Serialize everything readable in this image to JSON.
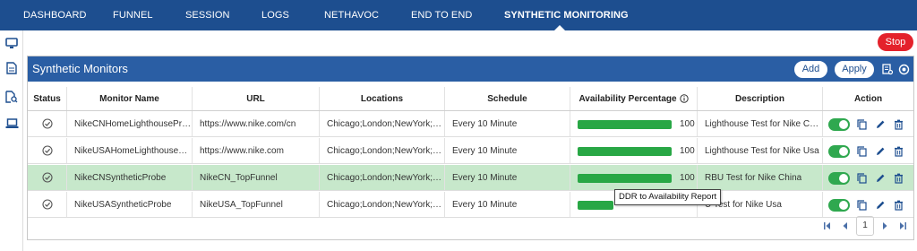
{
  "nav": {
    "tabs": [
      {
        "label": "DASHBOARD"
      },
      {
        "label": "FUNNEL"
      },
      {
        "label": "SESSION"
      },
      {
        "label": "LOGS"
      },
      {
        "label": "NETHAVOC"
      },
      {
        "label": "END TO END"
      },
      {
        "label": "SYNTHETIC MONITORING"
      }
    ],
    "active_tab": "SYNTHETIC MONITORING"
  },
  "sidebar": {
    "icons": [
      "monitor-icon",
      "document-icon",
      "document-search-icon",
      "laptop-icon"
    ]
  },
  "stop_label": "Stop",
  "panel": {
    "title": "Synthetic Monitors",
    "add_label": "Add",
    "apply_label": "Apply",
    "icons": [
      "report-icon",
      "refresh-settings-icon"
    ]
  },
  "table": {
    "headers": {
      "status": "Status",
      "name": "Monitor Name",
      "url": "URL",
      "locations": "Locations",
      "schedule": "Schedule",
      "availability": "Availability Percentage",
      "description": "Description",
      "action": "Action"
    },
    "rows": [
      {
        "name": "NikeCNHomeLighthousePro...",
        "url": "https://www.nike.com/cn",
        "locations": "Chicago;London;NewYork;T...",
        "schedule": "Every 10 Minute",
        "availability": 100,
        "availability_label": "100",
        "description": "Lighthouse Test for Nike Chi...",
        "enabled": true
      },
      {
        "name": "NikeUSAHomeLighthousePr...",
        "url": "https://www.nike.com",
        "locations": "Chicago;London;NewYork;T...",
        "schedule": "Every 10 Minute",
        "availability": 100,
        "availability_label": "100",
        "description": "Lighthouse Test for Nike Usa",
        "enabled": true
      },
      {
        "name": "NikeCNSyntheticProbe",
        "url": "NikeCN_TopFunnel",
        "locations": "Chicago;London;NewYork;T...",
        "schedule": "Every 10 Minute",
        "availability": 100,
        "availability_label": "100",
        "description": "RBU Test for Nike China",
        "enabled": true,
        "selected": true
      },
      {
        "name": "NikeUSASyntheticProbe",
        "url": "NikeUSA_TopFunnel",
        "locations": "Chicago;London;NewYork;T...",
        "schedule": "Every 10 Minute",
        "availability": 100,
        "availability_label": "",
        "description": "U Test for Nike Usa",
        "enabled": true
      }
    ]
  },
  "tooltip": "DDR to Availability Report",
  "pager": {
    "page": "1"
  },
  "colors": {
    "nav_bg": "#1d4e8f",
    "panel_header": "#2a5ea4",
    "stop": "#e4222b",
    "bar": "#28a745",
    "toggle_on": "#2fa84f",
    "selected_row": "#c7e8cb"
  }
}
